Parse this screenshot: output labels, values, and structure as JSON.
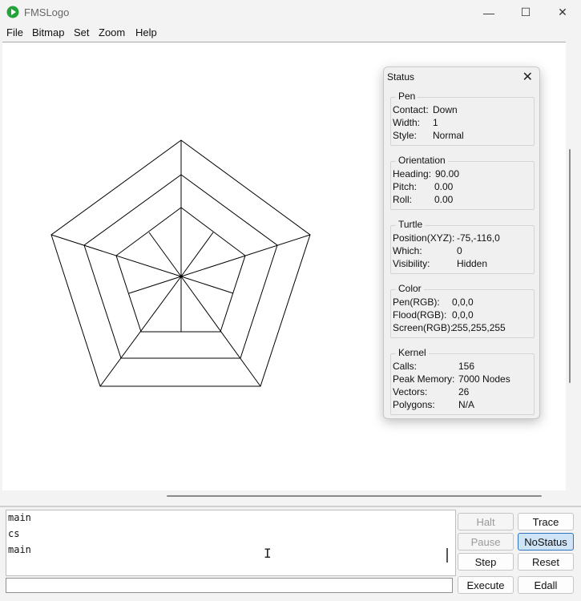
{
  "window": {
    "title": "FMSLogo",
    "controls": {
      "minimize": "—",
      "maximize": "☐",
      "close": "✕"
    }
  },
  "menu": [
    "File",
    "Bitmap",
    "Set",
    "Zoom",
    "Help"
  ],
  "canvas": {
    "drawing": "nested pentagons (pentagon web) drawn by turtle",
    "stroke_color": "#000000",
    "background_color": "#ffffff"
  },
  "status": {
    "title": "Status",
    "close_icon": "close-icon",
    "pen": {
      "label": "Pen",
      "rows": [
        {
          "key": "Contact:",
          "value": "Down"
        },
        {
          "key": "Width:",
          "value": "1"
        },
        {
          "key": "Style:",
          "value": "Normal"
        }
      ]
    },
    "orientation": {
      "label": "Orientation",
      "rows": [
        {
          "key": "Heading:",
          "value": "90.00"
        },
        {
          "key": "Pitch:",
          "value": "0.00"
        },
        {
          "key": "Roll:",
          "value": "0.00"
        }
      ]
    },
    "turtle": {
      "label": "Turtle",
      "rows": [
        {
          "key": "Position(XYZ):",
          "value": "-75,-116,0"
        },
        {
          "key": "Which:",
          "value": "0"
        },
        {
          "key": "Visibility:",
          "value": "Hidden"
        }
      ]
    },
    "color": {
      "label": "Color",
      "rows": [
        {
          "key": "Pen(RGB):",
          "value": "0,0,0"
        },
        {
          "key": "Flood(RGB):",
          "value": "0,0,0"
        },
        {
          "key": "Screen(RGB):",
          "value": "255,255,255"
        }
      ]
    },
    "kernel": {
      "label": "Kernel",
      "rows": [
        {
          "key": "Calls:",
          "value": "156"
        },
        {
          "key": "Peak Memory:",
          "value": "7000 Nodes"
        },
        {
          "key": "Vectors:",
          "value": "26"
        },
        {
          "key": "Polygons:",
          "value": "N/A"
        }
      ]
    }
  },
  "history": [
    "main",
    "cs",
    "main"
  ],
  "input": {
    "value": ""
  },
  "buttons": {
    "halt": "Halt",
    "trace": "Trace",
    "pause": "Pause",
    "nostatus": "NoStatus",
    "step": "Step",
    "reset": "Reset",
    "execute": "Execute",
    "edall": "Edall"
  }
}
